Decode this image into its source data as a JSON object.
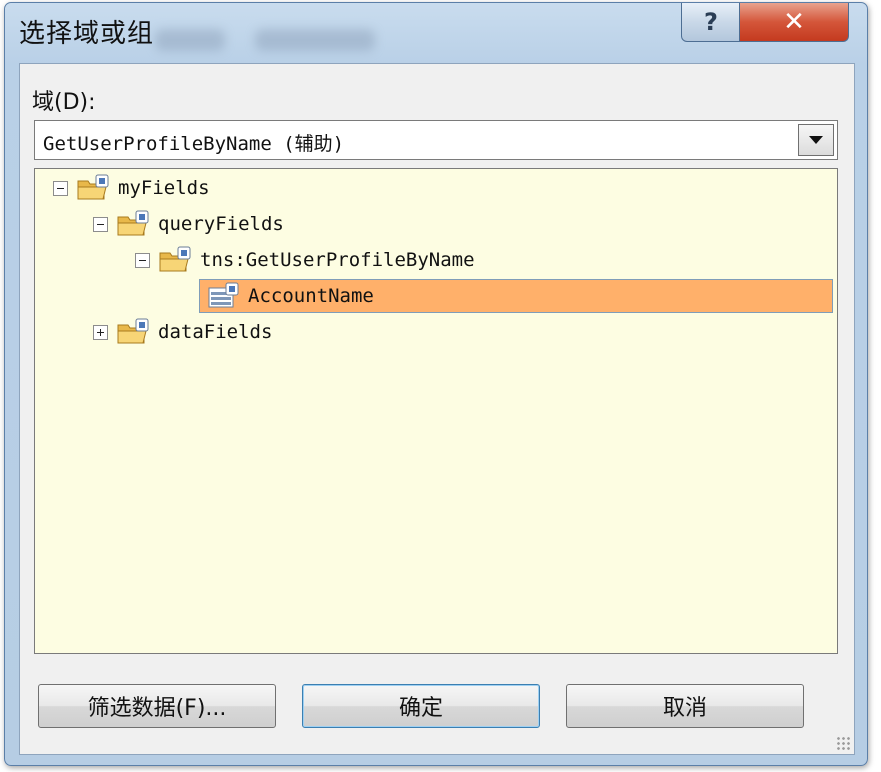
{
  "window": {
    "title": "选择域或组",
    "help_glyph": "?",
    "close_glyph": "✕"
  },
  "domain": {
    "label": "域(D):",
    "selected_value": "GetUserProfileByName (辅助)"
  },
  "tree": {
    "nodes": [
      {
        "label": "myFields",
        "expander": "minus",
        "icon": "folder-icon"
      },
      {
        "label": "queryFields",
        "expander": "minus",
        "icon": "folder-icon"
      },
      {
        "label": "tns:GetUserProfileByName",
        "expander": "minus",
        "icon": "folder-icon"
      },
      {
        "label": "AccountName",
        "expander": "none",
        "icon": "field-icon",
        "selected": true
      },
      {
        "label": "dataFields",
        "expander": "plus",
        "icon": "folder-icon"
      }
    ]
  },
  "buttons": {
    "filter_label": "筛选数据(F)...",
    "ok_label": "确定",
    "cancel_label": "取消"
  },
  "colors": {
    "tree_background": "#fdfde2",
    "selection": "#ffb06a",
    "close_button": "#d4563a"
  }
}
